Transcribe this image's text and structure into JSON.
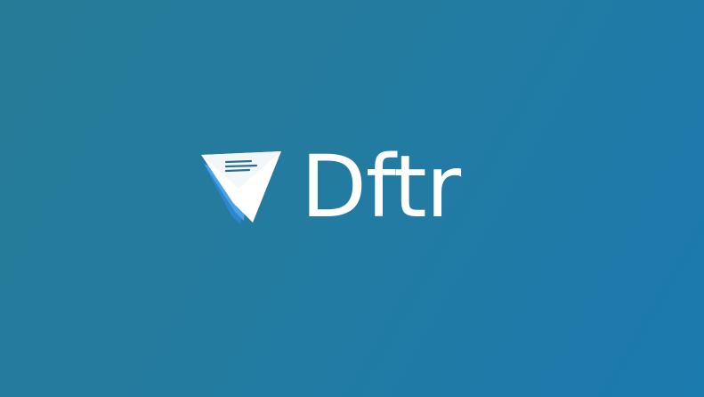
{
  "app": {
    "wordmark": "Dftr",
    "icon": "paper-plane-icon"
  },
  "colors": {
    "background_start": "#267b97",
    "background_end": "#1b7aae",
    "logo_primary": "#ffffff",
    "logo_accent": "#4aa3e6",
    "logo_lines": "#2a6f8e"
  }
}
